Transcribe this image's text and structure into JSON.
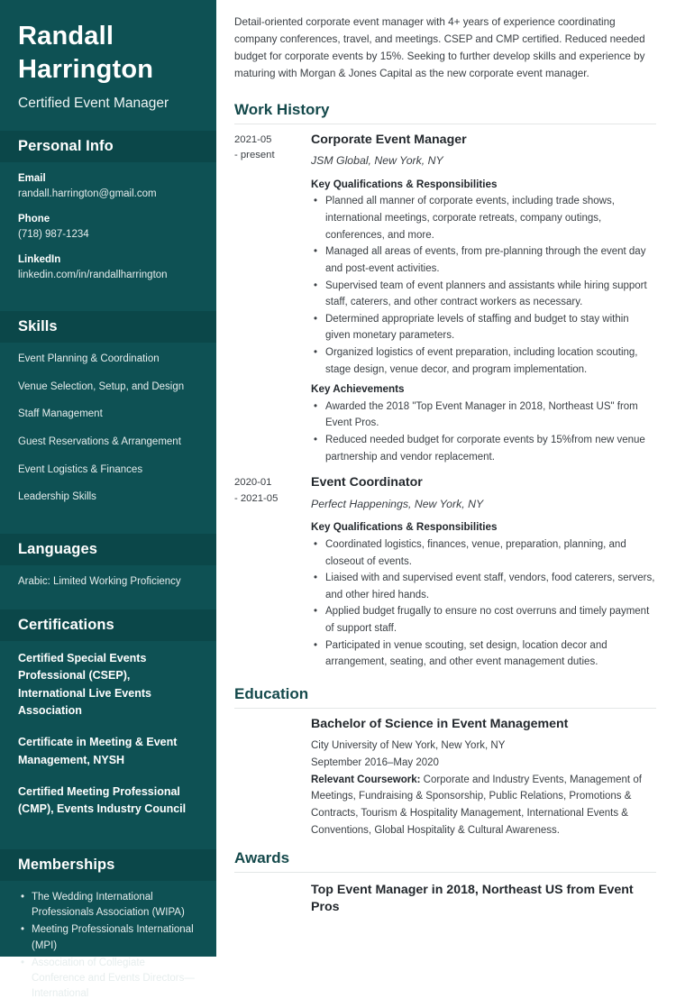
{
  "sidebar": {
    "name": "Randall Harrington",
    "job_title": "Certified Event Manager",
    "personal_info": {
      "heading": "Personal Info",
      "items": [
        {
          "label": "Email",
          "value": "randall.harrington@gmail.com"
        },
        {
          "label": "Phone",
          "value": "(718) 987-1234"
        },
        {
          "label": "LinkedIn",
          "value": "linkedin.com/in/randallharrington"
        }
      ]
    },
    "skills": {
      "heading": "Skills",
      "items": [
        "Event Planning & Coordination",
        "Venue Selection, Setup, and Design",
        "Staff Management",
        "Guest Reservations & Arrangement",
        "Event Logistics & Finances",
        "Leadership Skills"
      ]
    },
    "languages": {
      "heading": "Languages",
      "items": [
        "Arabic: Limited Working Proficiency"
      ]
    },
    "certifications": {
      "heading": "Certifications",
      "items": [
        "Certified Special Events Professional (CSEP), International Live Events Association",
        "Certificate in Meeting & Event Management, NYSH",
        "Certified Meeting Professional (CMP), Events Industry Council"
      ]
    },
    "memberships": {
      "heading": "Memberships",
      "items": [
        "The Wedding International Professionals Association (WIPA)",
        "Meeting Professionals International (MPI)",
        "Association of Collegiate Conference and Events Directors—International"
      ]
    }
  },
  "main": {
    "summary": "Detail-oriented corporate event manager with 4+ years of experience coordinating company conferences, travel, and meetings. CSEP and CMP certified. Reduced needed budget for corporate events by 15%. Seeking to further develop skills and experience by maturing with Morgan & Jones Capital as the new corporate event manager.",
    "work_history": {
      "heading": "Work History",
      "entries": [
        {
          "date_start": "2021-05",
          "date_end": "- present",
          "title": "Corporate Event Manager",
          "company": "JSM Global, New York, NY",
          "qualifications_label": "Key Qualifications & Responsibilities",
          "qualifications": [
            "Planned all manner of corporate events, including trade shows, international meetings, corporate retreats, company outings, conferences, and more.",
            "Managed all areas of events, from pre-planning through the event day and post-event activities.",
            "Supervised team of event planners and assistants while hiring support staff, caterers, and other contract workers as necessary.",
            "Determined appropriate levels of staffing and budget to stay within given monetary parameters.",
            "Organized logistics of event preparation, including location scouting, stage design, venue decor, and program implementation."
          ],
          "achievements_label": "Key Achievements",
          "achievements": [
            "Awarded the 2018 \"Top Event Manager in 2018, Northeast US\" from Event Pros.",
            "Reduced needed budget for corporate events by 15%from new venue partnership and vendor replacement."
          ]
        },
        {
          "date_start": "2020-01",
          "date_end": "- 2021-05",
          "title": "Event Coordinator",
          "company": "Perfect Happenings, New York, NY",
          "qualifications_label": "Key Qualifications & Responsibilities",
          "qualifications": [
            "Coordinated logistics, finances, venue, preparation, planning, and closeout of events.",
            "Liaised with and supervised event staff, vendors, food caterers, servers, and other hired hands.",
            "Applied budget frugally to ensure no cost overruns and timely payment of support staff.",
            "Participated in venue scouting, set design, location decor and arrangement, seating, and other event management duties."
          ],
          "achievements_label": "",
          "achievements": []
        }
      ]
    },
    "education": {
      "heading": "Education",
      "degree": "Bachelor of Science in Event Management",
      "school": "City University of New York, New York, NY",
      "dates": "September 2016–May 2020",
      "coursework_label": "Relevant Coursework:",
      "coursework": " Corporate and Industry Events, Management of Meetings, Fundraising & Sponsorship, Public Relations, Promotions & Contracts, Tourism & Hospitality Management, International Events & Conventions, Global Hospitality & Cultural Awareness."
    },
    "awards": {
      "heading": "Awards",
      "title": "Top Event Manager in 2018, Northeast US from Event Pros"
    }
  }
}
